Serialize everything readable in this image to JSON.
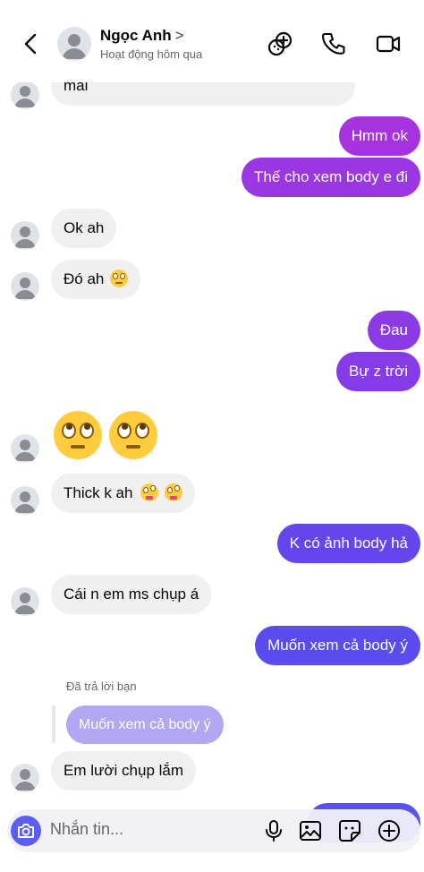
{
  "header": {
    "name": "Ngọc Anh",
    "chevron": ">",
    "status": "Hoạt động hôm qua",
    "icons": [
      "back-icon",
      "games-icon",
      "phone-icon",
      "video-icon"
    ]
  },
  "colors": {
    "accent": "#7b3ff2",
    "outgoing_top": "#a433e0",
    "outgoing_bottom": "#5b4ef0",
    "incoming": "#f0f0f0"
  },
  "messages": {
    "m0": "mai",
    "m1": "Hmm ok",
    "m2": "Thế cho xem body e đi",
    "m3": "Ok ah",
    "m4": "Đó ah",
    "m5": "Đau",
    "m6": "Bự z trời",
    "m7": "Thick k ah",
    "m8": "K có ảnh body hả",
    "m9": "Cái n em ms chụp á",
    "m10": "Muốn xem cả body ý",
    "reply_label": "Đã trả lời bạn",
    "reply_quote": "Muốn xem cả body ý",
    "m11": "Em lười chụp lắm"
  },
  "composer": {
    "placeholder": "Nhắn tin...",
    "icons": [
      "camera-icon",
      "microphone-icon",
      "image-icon",
      "sticker-icon",
      "plus-icon"
    ]
  }
}
